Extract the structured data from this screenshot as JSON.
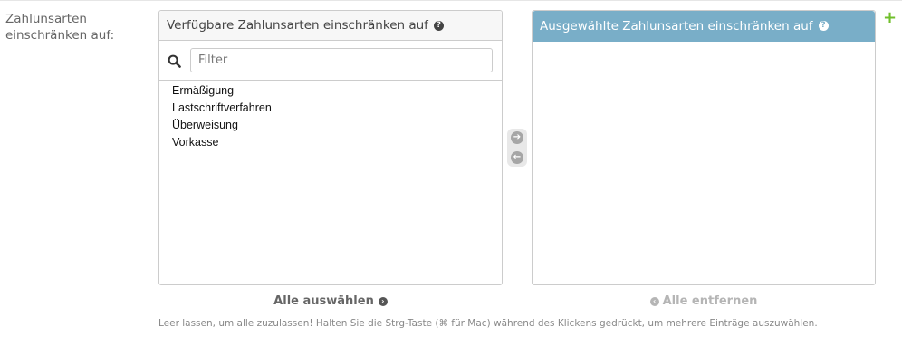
{
  "field_label": "Zahlunsarten einschränken auf:",
  "available": {
    "title": "Verfügbare Zahlunsarten einschränken auf",
    "filter_placeholder": "Filter",
    "options": [
      "Ermäßigung",
      "Lastschriftverfahren",
      "Überweisung",
      "Vorkasse"
    ]
  },
  "chosen": {
    "title": "Ausgewählte Zahlunsarten einschränken auf",
    "options": []
  },
  "actions": {
    "choose_all": "Alle auswählen",
    "remove_all": "Alle entfernen",
    "add_icon": "+"
  },
  "help_text": "Leer lassen, um alle zuzulassen! Halten Sie die Strg-Taste (⌘ für Mac) während des Klickens gedrückt, um mehrere Einträge auszuwählen.",
  "colors": {
    "chosen_header": "#79aec8",
    "add_green": "#70bf2b"
  }
}
